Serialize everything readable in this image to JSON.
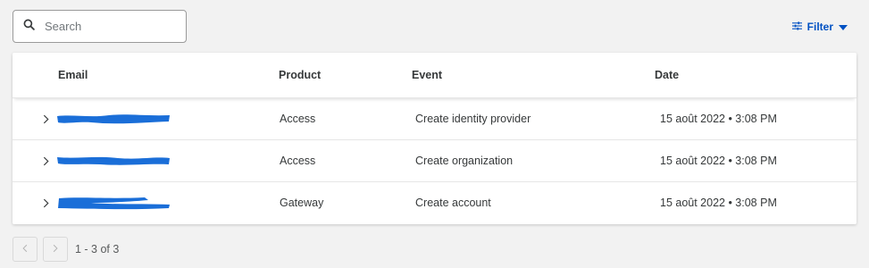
{
  "search": {
    "placeholder": "Search"
  },
  "filter": {
    "label": "Filter"
  },
  "table": {
    "headers": {
      "email": "Email",
      "product": "Product",
      "event": "Event",
      "date": "Date"
    },
    "rows": [
      {
        "email": "",
        "product": "Access",
        "event": "Create identity provider",
        "date": "15 août 2022 • 3:08 PM"
      },
      {
        "email": "",
        "product": "Access",
        "event": "Create organization",
        "date": "15 août 2022 • 3:08 PM"
      },
      {
        "email": "",
        "product": "Gateway",
        "event": "Create account",
        "date": "15 août 2022 • 3:08 PM"
      }
    ]
  },
  "pagination": {
    "range": "1 - 3 of 3"
  },
  "colors": {
    "accent": "#0051c3",
    "redaction": "#1a6ed8"
  }
}
